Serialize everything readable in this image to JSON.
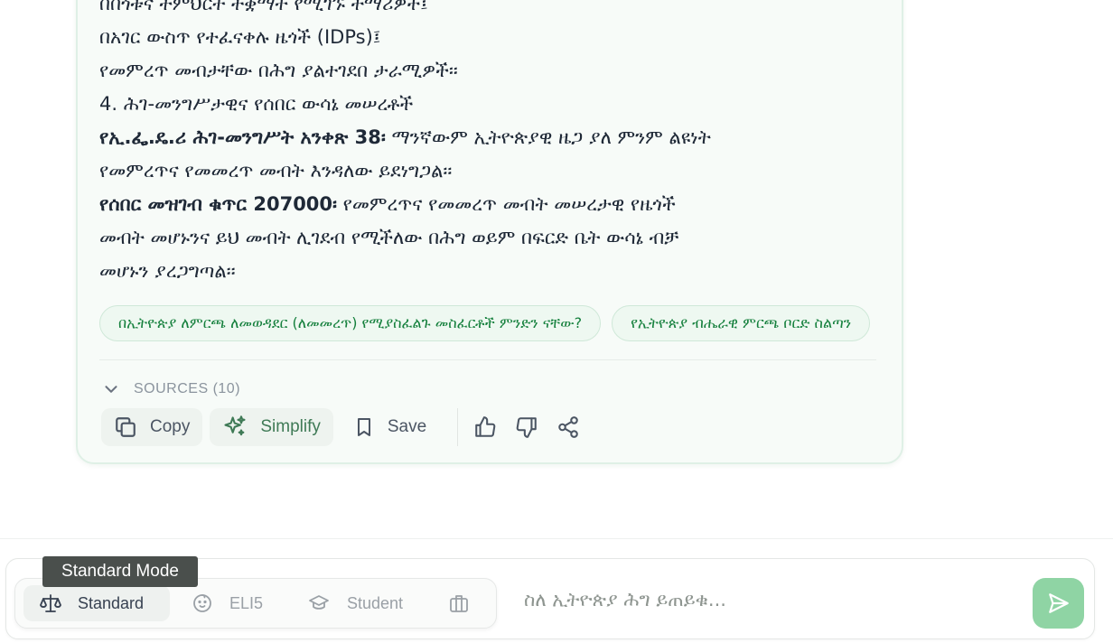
{
  "answer": {
    "lines": [
      {
        "strong": "",
        "text": "በበጎቱና ተምህርት ተቋማት የሚገኙ ተማሪዎች፤"
      },
      {
        "strong": "",
        "text": "በአገር ውስጥ የተፈናቀሉ ዜጎች (IDPs)፤"
      },
      {
        "strong": "",
        "text": "የመምረጥ መብታቸው በሕግ ያልተገደበ ታራሚዎች፡፡"
      },
      {
        "strong": "",
        "text": "4. ሕገ-መንግሥታዊና የሰበር ውሳኔ መሠረቶች"
      },
      {
        "strong": "የኢ.ፌ.ዴ.ሪ ሕገ-መንግሥት አንቀጽ 38፡",
        "text": " ማንኛውም ኢትዮጵያዊ ዜጋ ያለ ምንም ልዩነት"
      },
      {
        "strong": "",
        "text": "የመምረጥና የመመረጥ መብት እንዳለው ይደነግጋል፡፡"
      },
      {
        "strong": "የሰበር መዝገብ ቁጥር 207000፡",
        "text": " የመምረጥና የመመረጥ መብት መሠረታዊ የዜጎች"
      },
      {
        "strong": "",
        "text": "መብት መሆኑንና ይህ መብት ሊገደብ የሚችለው በሕግ ወይም በፍርድ ቤት ውሳኔ ብቻ"
      },
      {
        "strong": "",
        "text": "መሆኑን ያረጋግጣል፡፡"
      }
    ],
    "suggestions": [
      "በኢትዮጵያ ለምርጫ ለመወዳደር (ለመመረጥ) የሚያስፈልጉ መስፈርቶች ምንድን ናቸው?",
      "የኢትዮጵያ ብሔራዊ ምርጫ ቦርድ ስልጣን"
    ],
    "sources_label": "SOURCES (10)"
  },
  "actions": {
    "copy": "Copy",
    "simplify": "Simplify",
    "save": "Save"
  },
  "composer": {
    "tooltip": "Standard Mode",
    "modes": [
      "Standard",
      "ELI5",
      "Student"
    ],
    "placeholder": "ስለ ኢትዮጵያ ሕግ ይጠይቁ..."
  },
  "colors": {
    "accent": "#15803d",
    "send_button": "#8fd4a4"
  }
}
